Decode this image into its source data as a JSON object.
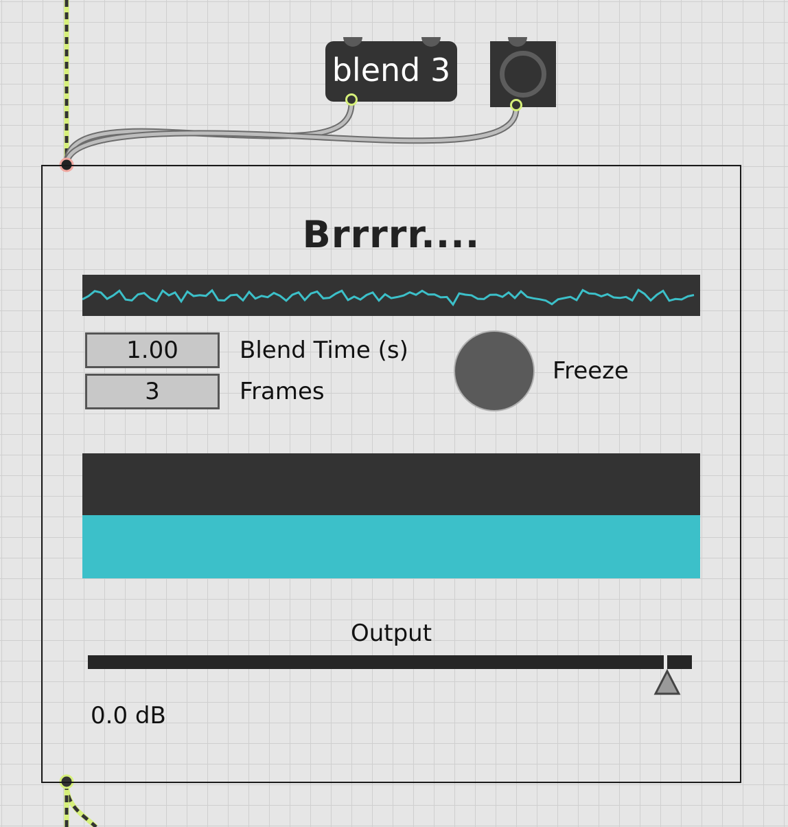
{
  "patch": {
    "message_box": {
      "label": "blend 3"
    },
    "bang_button": {
      "icon": "bang-ring-icon"
    },
    "colors": {
      "object_fill": "#333333",
      "patch_cord_active": "#d6f07a",
      "accent": "#3cc0c9",
      "grid_line": "#cfcfcf",
      "canvas": "#e6e6e6"
    }
  },
  "bpatcher": {
    "title": "Brrrrr....",
    "blend_time": {
      "value": "1.00",
      "label": "Blend Time (s)"
    },
    "frames": {
      "value": "3",
      "label": "Frames"
    },
    "freeze": {
      "label": "Freeze",
      "state": "off"
    },
    "meter": {
      "level": 0.5
    },
    "output": {
      "label": "Output",
      "readout": "0.0 dB",
      "level": 0.96
    }
  }
}
